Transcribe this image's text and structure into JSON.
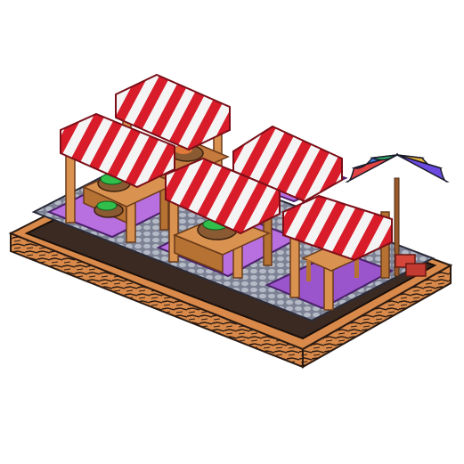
{
  "asset": {
    "kind": "isometric-building-sprite",
    "subject": "market-stalls"
  },
  "palette": {
    "base_orange": "#d98a4a",
    "base_dark": "#2a1a12",
    "floor_purple": "#b86fe0",
    "floor_stone": "#9aa0b0",
    "wood": "#d9924f",
    "wood_dark": "#9a5a2c",
    "awning_red": "#d81c2a",
    "awning_white": "#f4f4f4",
    "produce_green": "#2fbf4a",
    "basket": "#8a5a32",
    "crate_red": "#d4473a"
  },
  "umbrella_colors": [
    "#e24343",
    "#3f7be0",
    "#2fb86a",
    "#d65ad0",
    "#e7b43a",
    "#6b4be0"
  ]
}
